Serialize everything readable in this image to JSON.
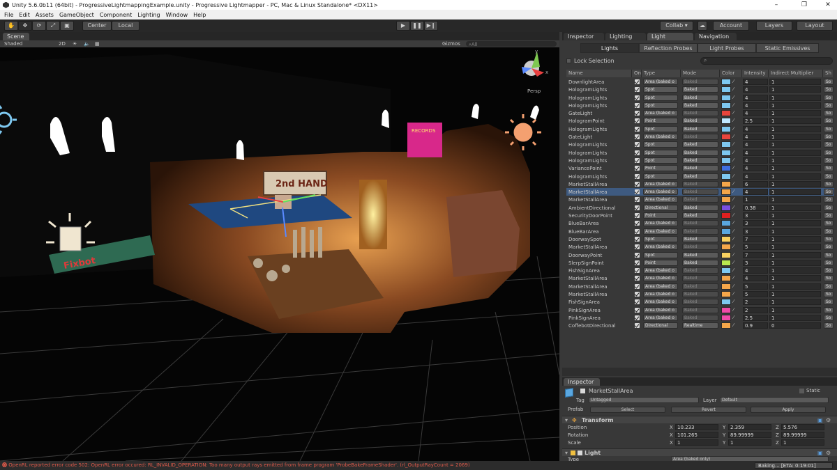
{
  "window": {
    "title": "Unity 5.6.0b11 (64bit) - ProgressiveLightmappingExample.unity - Progressive Lightmapper - PC, Mac & Linux Standalone* <DX11>",
    "minimize": "–",
    "maximize": "❐",
    "close": "✕"
  },
  "menu": [
    "File",
    "Edit",
    "Assets",
    "GameObject",
    "Component",
    "Lighting",
    "Window",
    "Help"
  ],
  "toolbar": {
    "pivot": "Center",
    "space": "Local",
    "collab": "Collab ▾",
    "account": "Account",
    "layers": "Layers",
    "layout": "Layout"
  },
  "scene": {
    "tab": "Scene",
    "shading": "Shaded",
    "mode2d": "2D",
    "gizmos": "Gizmos",
    "search": "All",
    "persp": "Persp",
    "sign_hand": "2nd HAND",
    "sign_records": "RECORDS",
    "sign_shop": "Fixbot",
    "axis_y": "y",
    "axis_x": "x"
  },
  "rightTabs": [
    "Inspector",
    "Lighting",
    "Light Explorer",
    "Navigation"
  ],
  "lightExplorer": {
    "subtabs": [
      "Lights",
      "Reflection Probes",
      "Light Probes",
      "Static Emissives"
    ],
    "lockLabel": "Lock Selection",
    "columns": [
      "Name",
      "On",
      "Type",
      "Mode",
      "Color",
      "Intensity",
      "Indirect Multiplier",
      "Sh"
    ],
    "shadowValue": "So",
    "rows": [
      {
        "name": "DownlightArea",
        "type": "Area (baked o",
        "mode": "Baked",
        "color": "#7ec8f0",
        "intensity": "4",
        "indirect": "1",
        "modeDim": true
      },
      {
        "name": "HologramLights",
        "type": "Spot",
        "mode": "Baked",
        "color": "#7ec8f0",
        "intensity": "4",
        "indirect": "1"
      },
      {
        "name": "HologramLights",
        "type": "Spot",
        "mode": "Baked",
        "color": "#7ec8f0",
        "intensity": "4",
        "indirect": "1"
      },
      {
        "name": "HologramLights",
        "type": "Spot",
        "mode": "Baked",
        "color": "#7ec8f0",
        "intensity": "4",
        "indirect": "1"
      },
      {
        "name": "GateLight",
        "type": "Area (baked o",
        "mode": "Baked",
        "color": "#e8453c",
        "intensity": "4",
        "indirect": "1",
        "modeDim": true
      },
      {
        "name": "HologramPoint",
        "type": "Point",
        "mode": "Baked",
        "color": "#bfe7ff",
        "intensity": "2.5",
        "indirect": "1"
      },
      {
        "name": "HologramLights",
        "type": "Spot",
        "mode": "Baked",
        "color": "#7ec8f0",
        "intensity": "4",
        "indirect": "1"
      },
      {
        "name": "GateLight",
        "type": "Area (baked o",
        "mode": "Baked",
        "color": "#e8453c",
        "intensity": "4",
        "indirect": "1",
        "modeDim": true
      },
      {
        "name": "HologramLights",
        "type": "Spot",
        "mode": "Baked",
        "color": "#7ec8f0",
        "intensity": "4",
        "indirect": "1"
      },
      {
        "name": "HologramLights",
        "type": "Spot",
        "mode": "Baked",
        "color": "#7ec8f0",
        "intensity": "4",
        "indirect": "1"
      },
      {
        "name": "HologramLights",
        "type": "Spot",
        "mode": "Baked",
        "color": "#7ec8f0",
        "intensity": "4",
        "indirect": "1"
      },
      {
        "name": "VariancePoint",
        "type": "Point",
        "mode": "Baked",
        "color": "#3f6fe0",
        "intensity": "4",
        "indirect": "1"
      },
      {
        "name": "HologramLights",
        "type": "Spot",
        "mode": "Baked",
        "color": "#7ec8f0",
        "intensity": "4",
        "indirect": "1"
      },
      {
        "name": "MarketStallArea",
        "type": "Area (baked o",
        "mode": "Baked",
        "color": "#f4a64a",
        "intensity": "6",
        "indirect": "1",
        "modeDim": true
      },
      {
        "name": "MarketStallArea",
        "type": "Area (baked o",
        "mode": "Baked",
        "color": "#f4a64a",
        "intensity": "4",
        "indirect": "1",
        "modeDim": true,
        "selected": true
      },
      {
        "name": "MarketStallArea",
        "type": "Area (baked o",
        "mode": "Baked",
        "color": "#f4a64a",
        "intensity": "1",
        "indirect": "1",
        "modeDim": true
      },
      {
        "name": "AmbientDirectional",
        "type": "Directional",
        "mode": "Baked",
        "color": "#7a4fe0",
        "intensity": "0.38",
        "indirect": "1"
      },
      {
        "name": "SecurityDoorPoint",
        "type": "Point",
        "mode": "Baked",
        "color": "#e02020",
        "intensity": "3",
        "indirect": "1"
      },
      {
        "name": "BlueBarArea",
        "type": "Area (baked o",
        "mode": "Baked",
        "color": "#5aa7e0",
        "intensity": "3",
        "indirect": "1",
        "modeDim": true
      },
      {
        "name": "BlueBarArea",
        "type": "Area (baked o",
        "mode": "Baked",
        "color": "#5aa7e0",
        "intensity": "3",
        "indirect": "1",
        "modeDim": true
      },
      {
        "name": "DoorwaySpot",
        "type": "Spot",
        "mode": "Baked",
        "color": "#f8d060",
        "intensity": "7",
        "indirect": "1"
      },
      {
        "name": "MarketStallArea",
        "type": "Area (baked o",
        "mode": "Baked",
        "color": "#f4a64a",
        "intensity": "5",
        "indirect": "1",
        "modeDim": true
      },
      {
        "name": "DoorwayPoint",
        "type": "Spot",
        "mode": "Baked",
        "color": "#f8d060",
        "intensity": "7",
        "indirect": "1"
      },
      {
        "name": "SlerpSignPoint",
        "type": "Point",
        "mode": "Baked",
        "color": "#b8e850",
        "intensity": "3",
        "indirect": "1"
      },
      {
        "name": "FishSignArea",
        "type": "Area (baked o",
        "mode": "Baked",
        "color": "#7ec8f0",
        "intensity": "4",
        "indirect": "1",
        "modeDim": true
      },
      {
        "name": "MarketStallArea",
        "type": "Area (baked o",
        "mode": "Baked",
        "color": "#f4a64a",
        "intensity": "4",
        "indirect": "1",
        "modeDim": true
      },
      {
        "name": "MarketStallArea",
        "type": "Area (baked o",
        "mode": "Baked",
        "color": "#f4a64a",
        "intensity": "5",
        "indirect": "1",
        "modeDim": true
      },
      {
        "name": "MarketStallArea",
        "type": "Area (baked o",
        "mode": "Baked",
        "color": "#f4a64a",
        "intensity": "5",
        "indirect": "1",
        "modeDim": true
      },
      {
        "name": "FishSignArea",
        "type": "Area (baked o",
        "mode": "Baked",
        "color": "#7ec8f0",
        "intensity": "2",
        "indirect": "1",
        "modeDim": true
      },
      {
        "name": "PinkSignArea",
        "type": "Area (baked o",
        "mode": "Baked",
        "color": "#f04aa8",
        "intensity": "2",
        "indirect": "1",
        "modeDim": true
      },
      {
        "name": "PinkSignArea",
        "type": "Area (baked o",
        "mode": "Baked",
        "color": "#f04aa8",
        "intensity": "2.5",
        "indirect": "1",
        "modeDim": true
      },
      {
        "name": "CoffebotDirectional",
        "type": "Directional",
        "mode": "Realtime",
        "color": "#f4a64a",
        "intensity": "0.9",
        "indirect": "0"
      }
    ]
  },
  "inspector": {
    "tab": "Inspector",
    "objectName": "MarketStallArea",
    "staticLabel": "Static",
    "tagLabel": "Tag",
    "tagValue": "Untagged",
    "layerLabel": "Layer",
    "layerValue": "Default",
    "prefabLabel": "Prefab",
    "prefabSelect": "Select",
    "prefabRevert": "Revert",
    "prefabApply": "Apply",
    "transform": "Transform",
    "position": {
      "label": "Position",
      "x": "10.233",
      "y": "2.359",
      "z": "5.576"
    },
    "rotation": {
      "label": "Rotation",
      "x": "101.265",
      "y": "89.99999",
      "z": "89.99999"
    },
    "scale": {
      "label": "Scale",
      "x": "1",
      "y": "1",
      "z": "1"
    },
    "light": "Light",
    "typeLabel": "Type",
    "typeValue": "Area (baked only)"
  },
  "status": {
    "error": "OpenRL reported error code 502: OpenRL error occured: RL_INVALID_OPERATION: Too many output rays emitted from frame program 'ProbeBakeFrameShader'. (rl_OutputRayCount = 2069)",
    "progress": "Baking... [ETA: 0:19:01]"
  }
}
